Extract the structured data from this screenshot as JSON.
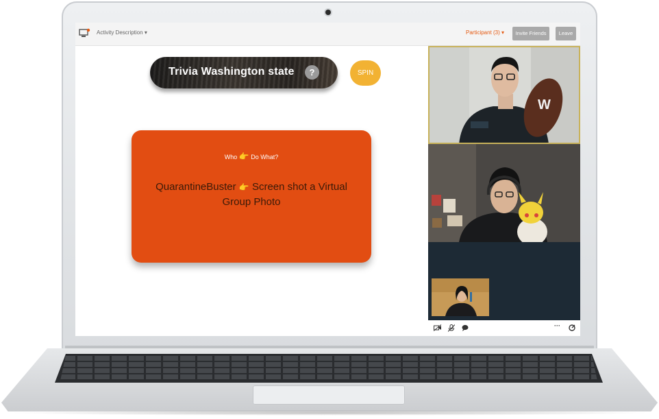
{
  "topbar": {
    "activity_label": "Activity Description",
    "participant_label": "Participant (3)",
    "invite_label": "Invite Friends",
    "leave_label": "Leave"
  },
  "game": {
    "title": "Trivia Washington state",
    "help_label": "?",
    "spin_label": "SPIN",
    "card_subtitle_who": "Who",
    "card_subtitle_what": "Do What?",
    "card_line1": "QuarantineBuster",
    "card_line2": "Screen shot a Virtual",
    "card_line3": "Group Photo",
    "pointer_glyph": "👉"
  },
  "colors": {
    "accent_orange": "#e24d12",
    "spin_yellow": "#f2b233",
    "video_dark": "#1d2a35"
  },
  "video": {
    "participant_count": 3,
    "controls": [
      "video-off-icon",
      "mic-off-icon",
      "chat-icon",
      "more-icon",
      "settings-icon"
    ]
  }
}
